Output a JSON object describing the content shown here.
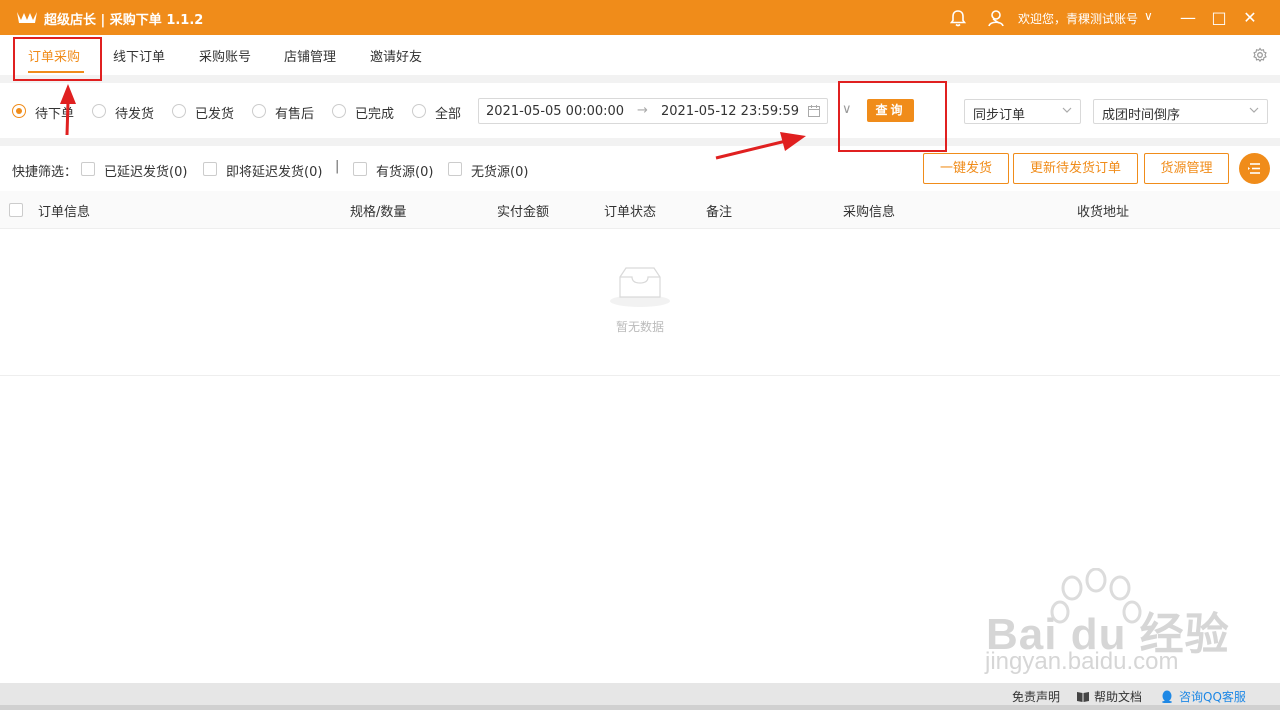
{
  "titlebar": {
    "title": "超级店长 | 采购下单 1.1.2",
    "welcome": "欢迎您，青稞测试账号",
    "welcome_chevron": "∨",
    "icons": [
      "crown-icon",
      "bell-icon",
      "user-icon",
      "minimize-icon",
      "maximize-icon",
      "close-icon"
    ],
    "minimize_glyph": "—",
    "maximize_glyph": "□",
    "close_glyph": "✕"
  },
  "menu": {
    "items": [
      {
        "label": "订单采购",
        "active": true
      },
      {
        "label": "线下订单",
        "active": false
      },
      {
        "label": "采购账号",
        "active": false
      },
      {
        "label": "店铺管理",
        "active": false
      },
      {
        "label": "邀请好友",
        "active": false
      }
    ]
  },
  "filters": {
    "statuses": [
      {
        "label": "待下单",
        "selected": true
      },
      {
        "label": "待发货",
        "selected": false
      },
      {
        "label": "已发货",
        "selected": false
      },
      {
        "label": "有售后",
        "selected": false
      },
      {
        "label": "已完成",
        "selected": false
      },
      {
        "label": "全部",
        "selected": false
      }
    ],
    "start_date": "2021-05-05 00:00:00",
    "range_arrow": "→",
    "end_date": "2021-05-12 23:59:59",
    "expand_chevron": "∨",
    "query_label": "查询",
    "sync_select": "同步订单",
    "sort_select": "成团时间倒序"
  },
  "quick": {
    "label": "快捷筛选：",
    "options": [
      "已延迟发货(0)",
      "即将延迟发货(0)",
      "有货源(0)",
      "无货源(0)"
    ],
    "separator": "|",
    "buttons": [
      "一键发货",
      "更新待发货订单",
      "货源管理"
    ]
  },
  "table": {
    "columns": [
      "订单信息",
      "规格/数量",
      "实付金额",
      "订单状态",
      "备注",
      "采购信息",
      "收货地址"
    ],
    "empty_text": "暂无数据"
  },
  "watermark": {
    "brand": "Bai du 经验",
    "url": "jingyan.baidu.com"
  },
  "statusbar": {
    "disclaimer": "免责声明",
    "help": "帮助文档",
    "qq": "咨询QQ客服"
  },
  "colors": {
    "accent": "#f08c1a",
    "annotation": "#e02020",
    "link": "#1e88e5"
  }
}
